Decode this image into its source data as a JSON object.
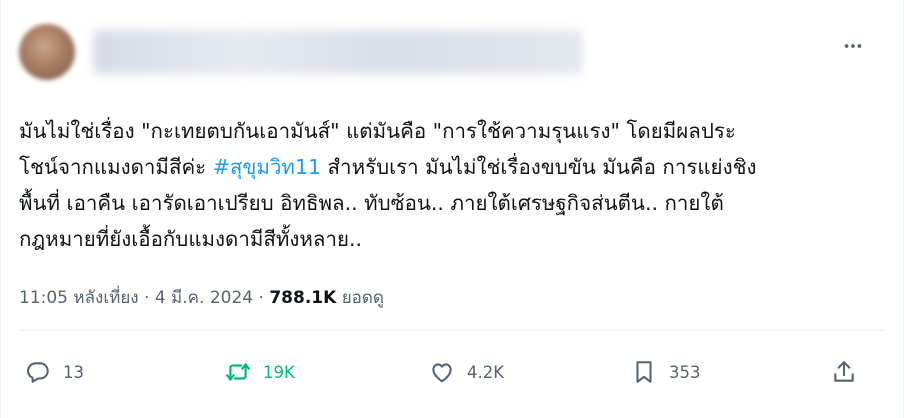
{
  "tweet": {
    "body_lines": [
      "มันไม่ใช่เรื่อง \"กะเทยตบกันเอามันส์\" แต่มันคือ \"การใช้ความรุนแรง\" โดยมีผลประ",
      "สำหรับเรา มันไม่ใช่เรื่องขบขัน มันคือ การแย่งชิง",
      "พื้นที่ เอาคืน เอารัดเอาเปรียบ อิทธิพล.. ทับซ้อน.. ภายใต้เศรษฐกิจส่นตีน.. กายใต้",
      "กฎหมายที่ยังเอื้อกับแมงดามีสีทั้งหลาย.."
    ],
    "line2_prefix": "โชน์จากแมงดามีสีค่ะ ",
    "hashtag": "#สุขุมวิท11",
    "line2_suffix": " สำหรับเรา มันไม่ใช่เรื่องขบขัน มันคือ การแย่งชิง",
    "time": "11:05 หลังเที่ยง",
    "separator": " · ",
    "date": "4 มี.ค. 2024",
    "views_count": "788.1K",
    "views_label": "ยอดดู"
  },
  "actions": {
    "replies": "13",
    "retweets": "19K",
    "likes": "4.2K",
    "bookmarks": "353"
  },
  "colors": {
    "text": "#0f1419",
    "muted": "#536471",
    "accent": "#1d9bf0",
    "retweet_active": "#00ba7c"
  },
  "icons": [
    "more-icon",
    "reply-icon",
    "retweet-icon",
    "like-icon",
    "bookmark-icon",
    "share-icon"
  ]
}
